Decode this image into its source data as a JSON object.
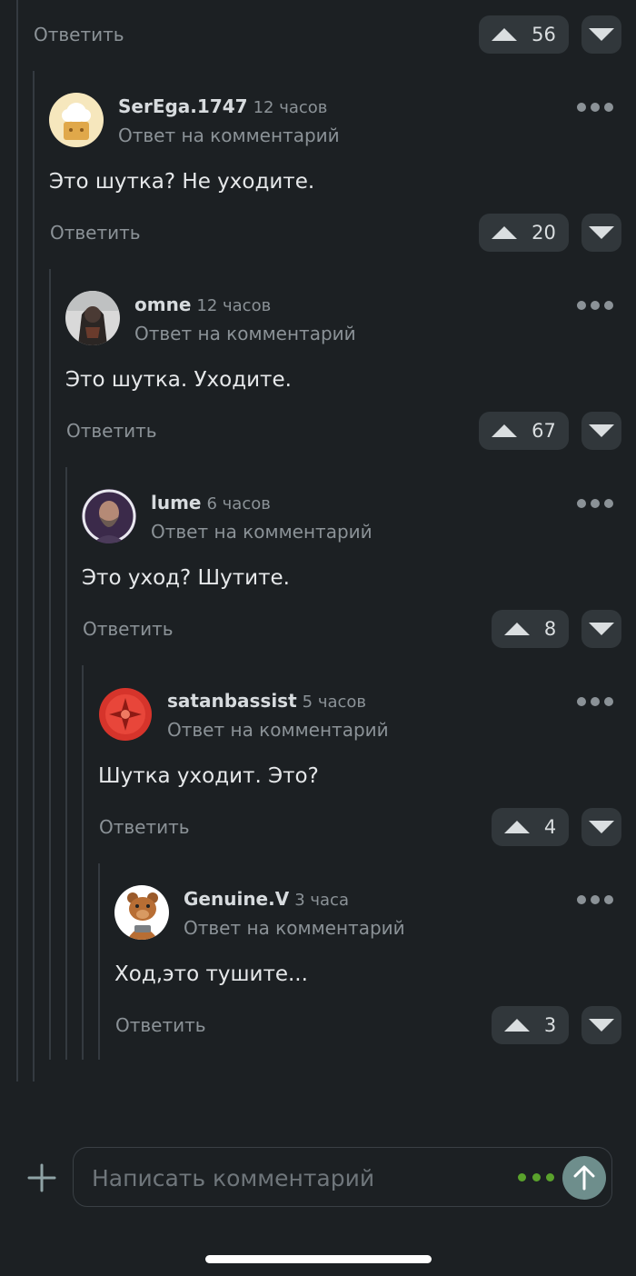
{
  "top_bar": {
    "reply_label": "Ответить",
    "votes": "56"
  },
  "comments": [
    {
      "author": "SerEga.1747",
      "time": "12 часов",
      "reply_to": "Ответ на комментарий",
      "text": "Это шутка? Не уходите.",
      "reply_label": "Ответить",
      "votes": "20",
      "avatar_icon": "chef-hat-avatar-icon"
    },
    {
      "author": "omne",
      "time": "12 часов",
      "reply_to": "Ответ на комментарий",
      "text": "Это шутка. Уходите.",
      "reply_label": "Ответить",
      "votes": "67",
      "avatar_icon": "dark-portrait-avatar-icon"
    },
    {
      "author": "lume",
      "time": "6 часов",
      "reply_to": "Ответ на комментарий",
      "text": "Это уход? Шутите.",
      "reply_label": "Ответить",
      "votes": "8",
      "avatar_icon": "bearded-man-avatar-icon"
    },
    {
      "author": "satanbassist",
      "time": "5 часов",
      "reply_to": "Ответ на комментарий",
      "text": "Шутка уходит. Это?",
      "reply_label": "Ответить",
      "votes": "4",
      "avatar_icon": "red-cross-avatar-icon"
    },
    {
      "author": "Genuine.V",
      "time": "3 часа",
      "reply_to": "Ответ на комментарий",
      "text": "Ход,это тушите...",
      "reply_label": "Ответить",
      "votes": "3",
      "avatar_icon": "cartoon-bear-avatar-icon"
    }
  ],
  "composer": {
    "placeholder": "Написать комментарий",
    "value": ""
  },
  "colors": {
    "background": "#1c2023",
    "button_bg": "#31373b",
    "muted_text": "#8b9297",
    "typing_indicator": "#5aa22c",
    "send_button": "#6e8e8c"
  }
}
